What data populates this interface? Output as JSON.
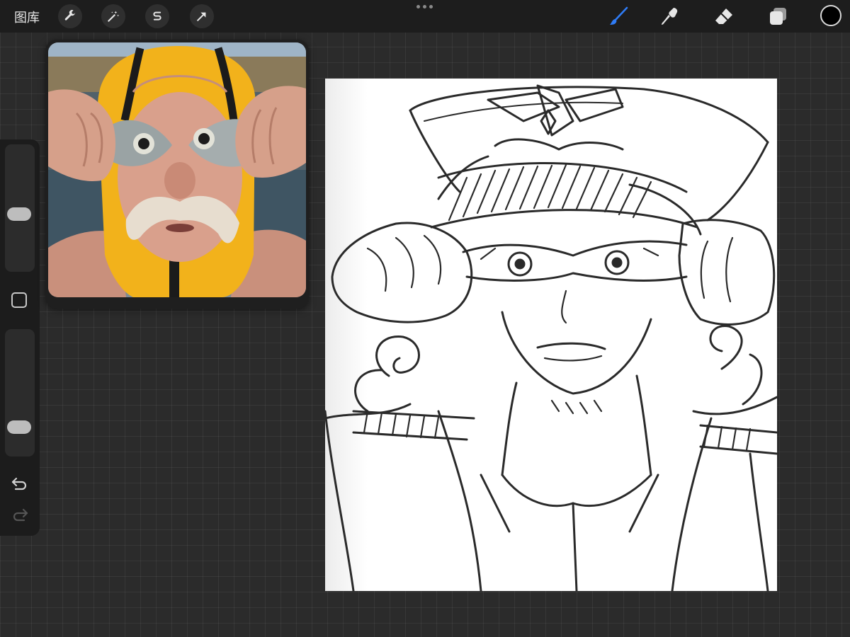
{
  "toolbar": {
    "gallery_label": "图库",
    "left_tools": [
      "wrench-icon",
      "magic-wand-icon",
      "selection-s-icon",
      "arrow-transform-icon"
    ],
    "right_tools": [
      "brush-icon",
      "smudge-icon",
      "eraser-icon",
      "layers-icon"
    ],
    "active_tool": "brush",
    "active_tool_color": "#2f7cf6",
    "current_color": "#000000"
  },
  "sidebar": {
    "brush_size_level": 0.45,
    "opacity_level": 0.2,
    "buttons": [
      "modify-button",
      "undo-button",
      "redo-button"
    ]
  },
  "reference": {
    "accent_color": "#f2b21b"
  }
}
